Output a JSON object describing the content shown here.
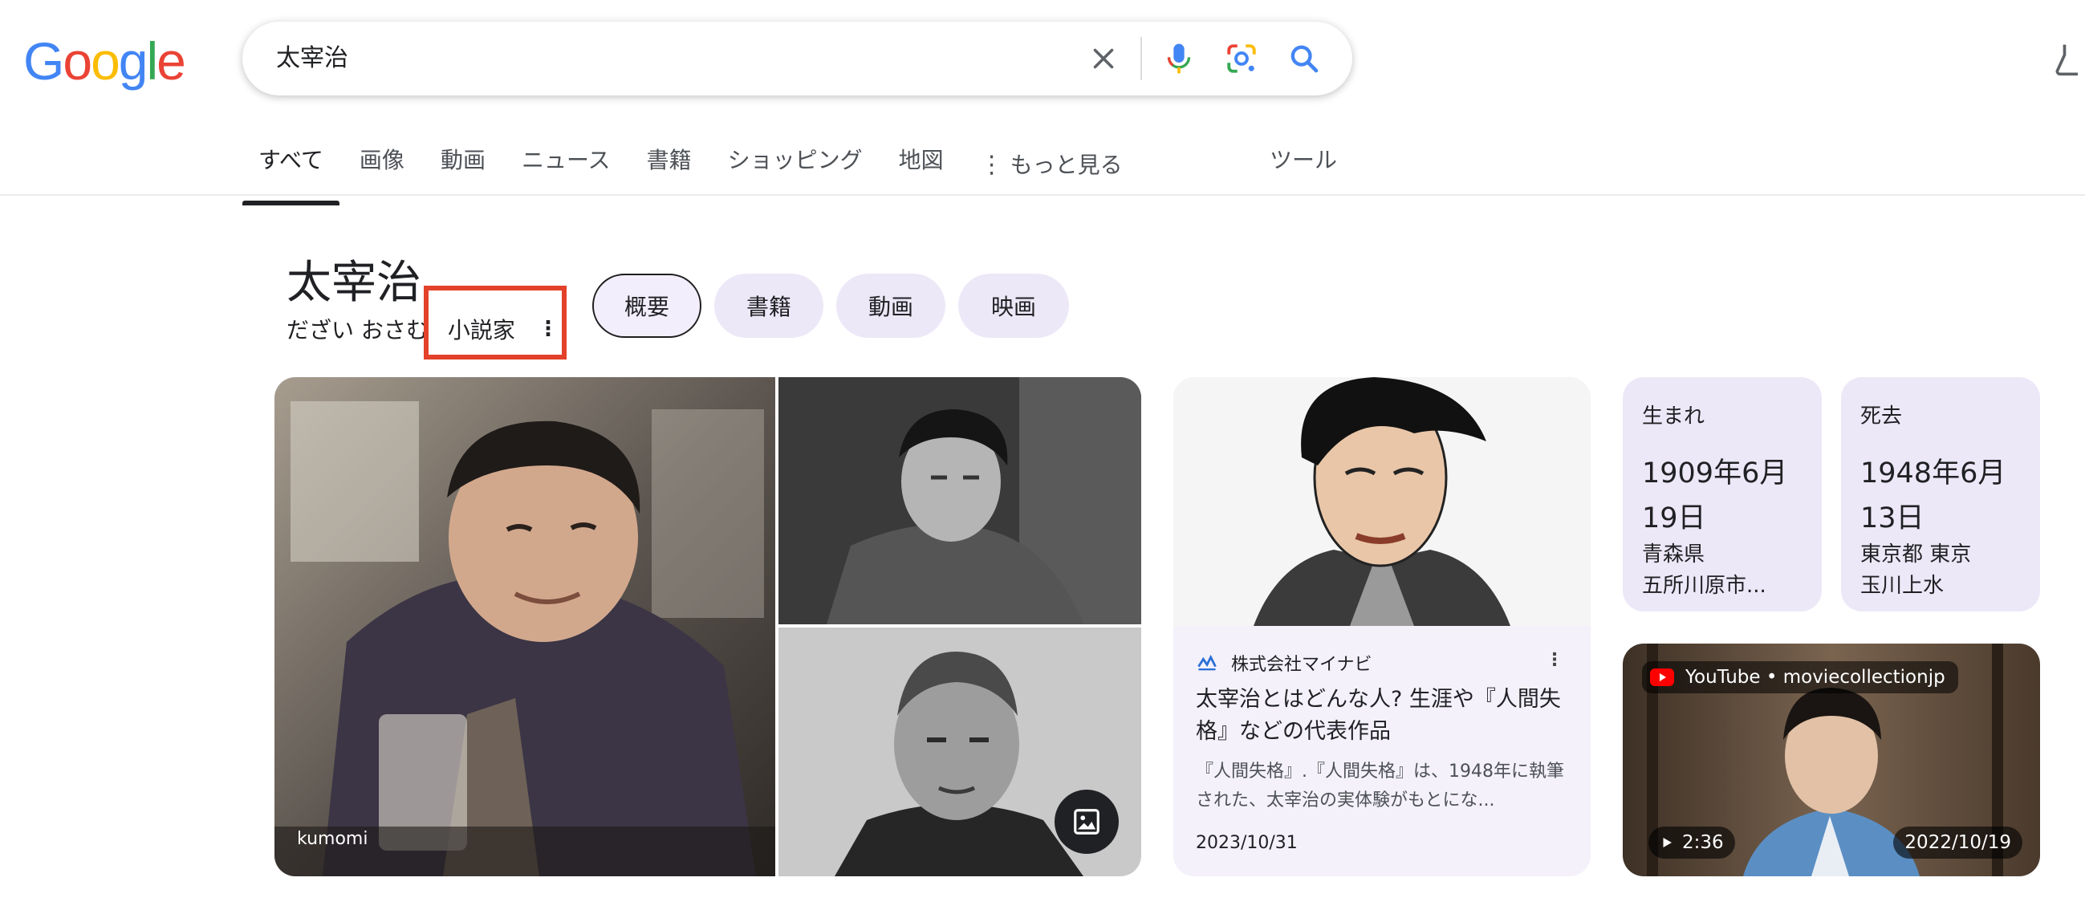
{
  "logo": {
    "letters": [
      "G",
      "o",
      "o",
      "g",
      "l",
      "e"
    ],
    "colors": [
      "#4285F4",
      "#EA4335",
      "#FBBC05",
      "#4285F4",
      "#34A853",
      "#EA4335"
    ]
  },
  "search": {
    "query": "太宰治"
  },
  "tabs": [
    {
      "label": "すべて",
      "active": true
    },
    {
      "label": "画像"
    },
    {
      "label": "動画"
    },
    {
      "label": "ニュース"
    },
    {
      "label": "書籍"
    },
    {
      "label": "ショッピング"
    },
    {
      "label": "地図"
    },
    {
      "label": "もっと見る"
    }
  ],
  "tools_label": "ツール",
  "entity": {
    "title": "太宰治",
    "reading": "だざい おさむ",
    "category": "小説家"
  },
  "chips": [
    {
      "label": "概要",
      "active": true
    },
    {
      "label": "書籍"
    },
    {
      "label": "動画"
    },
    {
      "label": "映画"
    }
  ],
  "images": {
    "main_caption": "kumomi"
  },
  "article": {
    "source": "株式会社マイナビ",
    "title": "太宰治とはどんな人? 生涯や『人間失格』などの代表作品",
    "snippet": "『人間失格』.『人間失格』は、1948年に執筆された、太宰治の実体験がもとにな...",
    "date": "2023/10/31"
  },
  "born": {
    "label": "生まれ",
    "value": "1909年6月19日",
    "place_line1": "青森県",
    "place_line2": "五所川原市..."
  },
  "died": {
    "label": "死去",
    "value": "1948年6月13日",
    "place_line1": "東京都 東京",
    "place_line2": "玉川上水"
  },
  "video": {
    "source": "YouTube • moviecollectionjp",
    "duration": "2:36",
    "date": "2022/10/19"
  },
  "accent_colors": {
    "highlight": "#E3412A",
    "chip_bg": "#EDE8F8"
  }
}
